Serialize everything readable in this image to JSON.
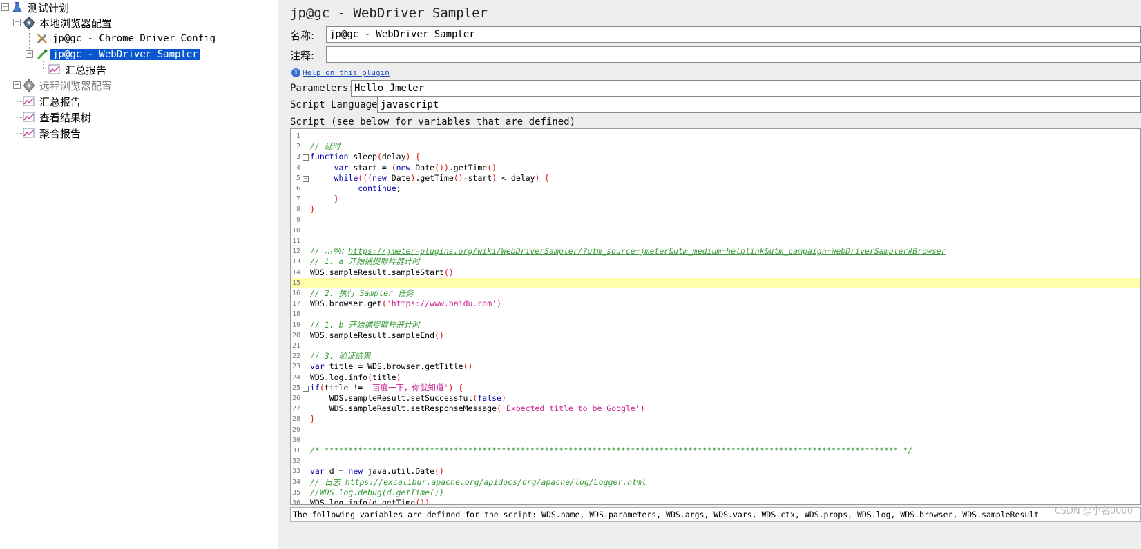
{
  "tree": {
    "items": [
      {
        "label": "测试计划",
        "icon": "beaker-icon"
      },
      {
        "label": "本地浏览器配置",
        "icon": "gear-icon"
      },
      {
        "label": "jp@gc - Chrome Driver Config",
        "icon": "wrench-icon"
      },
      {
        "label": "jp@gc - WebDriver Sampler",
        "icon": "pipette-icon"
      },
      {
        "label": "汇总报告",
        "icon": "chart-icon"
      },
      {
        "label": "远程浏览器配置",
        "icon": "gear-icon"
      },
      {
        "label": "汇总报告",
        "icon": "chart-icon"
      },
      {
        "label": "查看结果树",
        "icon": "chart-icon"
      },
      {
        "label": "聚合报告",
        "icon": "chart-icon"
      }
    ]
  },
  "panel": {
    "title": "jp@gc - WebDriver Sampler",
    "name_label": "名称:",
    "name_value": "jp@gc - WebDriver Sampler",
    "comment_label": "注释:",
    "comment_value": "",
    "help_link": "Help on this plugin",
    "parameters_label": "Parameters:",
    "parameters_value": "Hello Jmeter",
    "language_label": "Script Language:",
    "language_value": "javascript",
    "script_label": "Script (see below for variables that are defined)",
    "status_text": "The following variables are defined for the script: WDS.name, WDS.parameters, WDS.args, WDS.vars, WDS.ctx, WDS.props, WDS.log, WDS.browser, WDS.sampleResult"
  },
  "editor": {
    "current_line": 15,
    "lines": [
      "",
      "// 延时",
      "function sleep(delay) {",
      "     var start = (new Date()).getTime()",
      "     while(((new Date).getTime()-start) < delay) {",
      "          continue;",
      "     }",
      "}",
      "",
      "",
      "",
      "// 示例：https://jmeter-plugins.org/wiki/WebDriverSampler/?utm_source=jmeter&utm_medium=helplink&utm_campaign=WebDriverSampler#Browser",
      "// 1. a 开始捕捉取样器计时",
      "WDS.sampleResult.sampleStart()",
      "",
      "// 2. 执行 Sampler 任务",
      "WDS.browser.get('https://www.baidu.com')",
      "",
      "// 1. b 开始捕捉取样器计时",
      "WDS.sampleResult.sampleEnd()",
      "",
      "// 3. 验证结果",
      "var title = WDS.browser.getTitle()",
      "WDS.log.info(title)",
      "if(title != '百度一下，你就知道') {",
      "    WDS.sampleResult.setSuccessful(false)",
      "    WDS.sampleResult.setResponseMessage('Expected title to be Google')",
      "}",
      "",
      "",
      "/* ************************************************************************************************************************ */",
      "",
      "var d = new java.util.Date()",
      "// 日志 https://excalibur.apache.org/apidocs/org/apache/log/Logger.html",
      "//WDS.log.debug(d.getTime())",
      "WDS.log.info(d.getTime())"
    ]
  },
  "watermark": "CSDN @小名0000"
}
